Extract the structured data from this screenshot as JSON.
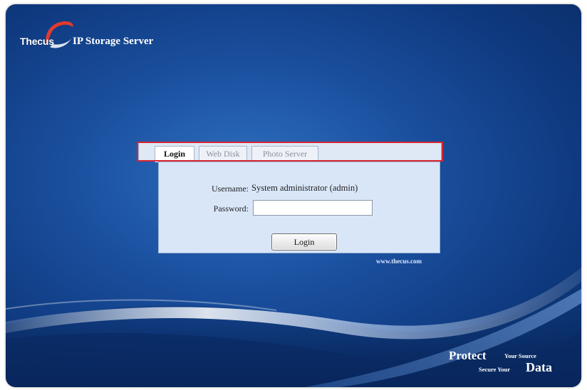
{
  "brand": {
    "logo_text": "Thecus",
    "product_name": "IP Storage Server"
  },
  "tabs": [
    {
      "label": "Login",
      "active": true
    },
    {
      "label": "Web Disk",
      "active": false
    },
    {
      "label": "Photo Server",
      "active": false
    }
  ],
  "form": {
    "username_label": "Username:",
    "username_value": "System administrator (admin)",
    "password_label": "Password:",
    "password_value": "",
    "login_button": "Login"
  },
  "footer": {
    "website": "www.thecus.com",
    "slogan_protect": "Protect",
    "slogan_source": "Your Source",
    "slogan_secure": "Secure Your",
    "slogan_data": "Data"
  },
  "colors": {
    "background": "#1a4f9e",
    "panel": "#d9e6f8",
    "highlight": "#d8242f"
  }
}
